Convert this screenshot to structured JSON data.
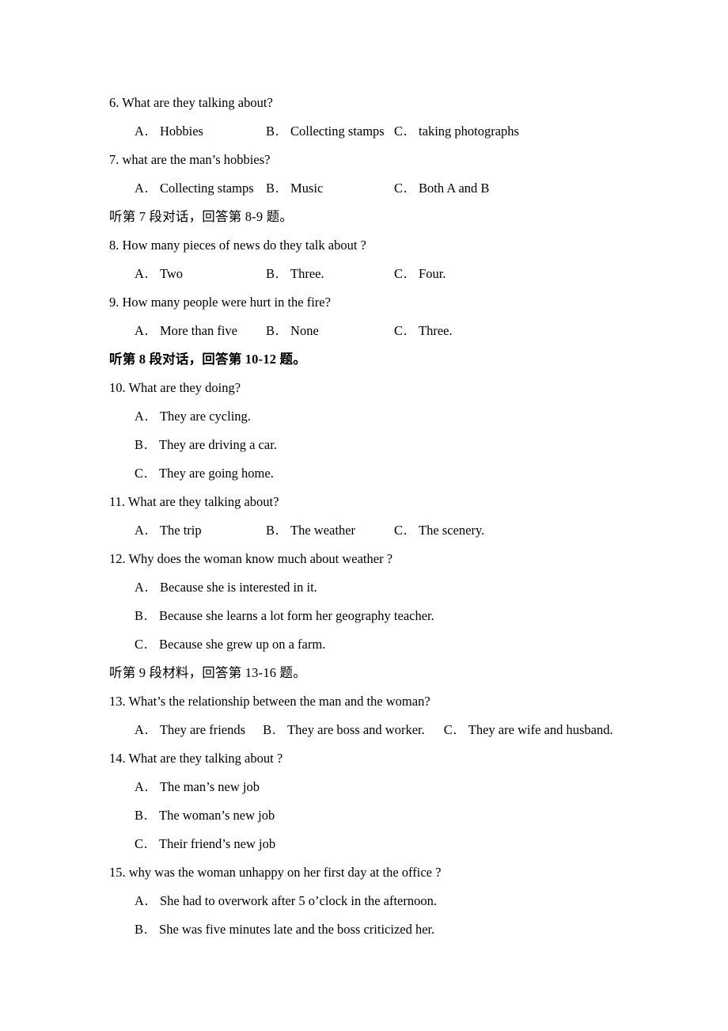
{
  "document": {
    "kind": "english-listening-exam-paper",
    "language_note": "Chinese section directives with English multiple-choice questions"
  },
  "separator": "．",
  "blocks": [
    {
      "type": "question",
      "name": "question-6",
      "stem": "6. What are they talking about?",
      "layout": "columns",
      "options": [
        {
          "label": "A",
          "text": "Hobbies"
        },
        {
          "label": "B",
          "text": "Collecting stamps"
        },
        {
          "label": "C",
          "text": "taking photographs"
        }
      ]
    },
    {
      "type": "question",
      "name": "question-7",
      "stem": "7. what are the man’s hobbies?",
      "layout": "columns",
      "options": [
        {
          "label": "A",
          "text": "Collecting stamps"
        },
        {
          "label": "B",
          "text": "Music"
        },
        {
          "label": "C",
          "text": "Both A and B"
        }
      ]
    },
    {
      "type": "section",
      "name": "section-directive-7",
      "text": "听第 7 段对话，回答第 8-9 题。",
      "bold": false
    },
    {
      "type": "question",
      "name": "question-8",
      "stem": "8. How many pieces of news do they talk about ?",
      "layout": "columns",
      "options": [
        {
          "label": "A",
          "text": "Two"
        },
        {
          "label": "B",
          "text": "Three."
        },
        {
          "label": "C",
          "text": "Four."
        }
      ]
    },
    {
      "type": "question",
      "name": "question-9",
      "stem": "9. How many people were hurt in the fire?",
      "layout": "columns",
      "options": [
        {
          "label": "A",
          "text": "More than five"
        },
        {
          "label": "B",
          "text": "None"
        },
        {
          "label": "C",
          "text": "Three."
        }
      ]
    },
    {
      "type": "section",
      "name": "section-directive-8",
      "text": "听第 8 段对话，回答第 10-12 题。",
      "bold": true
    },
    {
      "type": "question",
      "name": "question-10",
      "stem": "10. What are they doing?",
      "layout": "stacked",
      "options": [
        {
          "label": "A",
          "text": "They are cycling."
        },
        {
          "label": "B",
          "text": "They are driving a car."
        },
        {
          "label": "C",
          "text": "They are going home."
        }
      ]
    },
    {
      "type": "question",
      "name": "question-11",
      "stem": "11. What are they talking about?",
      "layout": "columns",
      "options": [
        {
          "label": "A",
          "text": "The trip"
        },
        {
          "label": "B",
          "text": "The weather"
        },
        {
          "label": "C",
          "text": "The scenery."
        }
      ]
    },
    {
      "type": "question",
      "name": "question-12",
      "stem": "12. Why does the woman know much about weather ?",
      "layout": "stacked",
      "options": [
        {
          "label": "A",
          "text": "Because she is interested in it."
        },
        {
          "label": "B",
          "text": "Because she learns a lot form her geography teacher."
        },
        {
          "label": "C",
          "text": "Because she grew up on a farm."
        }
      ]
    },
    {
      "type": "section",
      "name": "section-directive-9",
      "text": "听第 9 段材料，回答第 13-16 题。",
      "bold": false
    },
    {
      "type": "question",
      "name": "question-13",
      "stem": "13. What’s the relationship between the man and the woman?",
      "layout": "flow",
      "options": [
        {
          "label": "A",
          "text": "They are friends"
        },
        {
          "label": "B",
          "text": "They are boss and worker."
        },
        {
          "label": "C",
          "text": "They are wife and husband."
        }
      ]
    },
    {
      "type": "question",
      "name": "question-14",
      "stem": "14. What are they talking about ?",
      "layout": "stacked",
      "options": [
        {
          "label": "A",
          "text": "The man’s new job"
        },
        {
          "label": "B",
          "text": "The woman’s new job"
        },
        {
          "label": "C",
          "text": "Their friend’s new job"
        }
      ]
    },
    {
      "type": "question",
      "name": "question-15",
      "stem": "15. why was the woman unhappy on her first day at the office ?",
      "layout": "stacked",
      "options": [
        {
          "label": "A",
          "text": "She had to overwork after 5 o’clock in the afternoon."
        },
        {
          "label": "B",
          "text": "She was five minutes late and the boss criticized her."
        }
      ]
    }
  ]
}
